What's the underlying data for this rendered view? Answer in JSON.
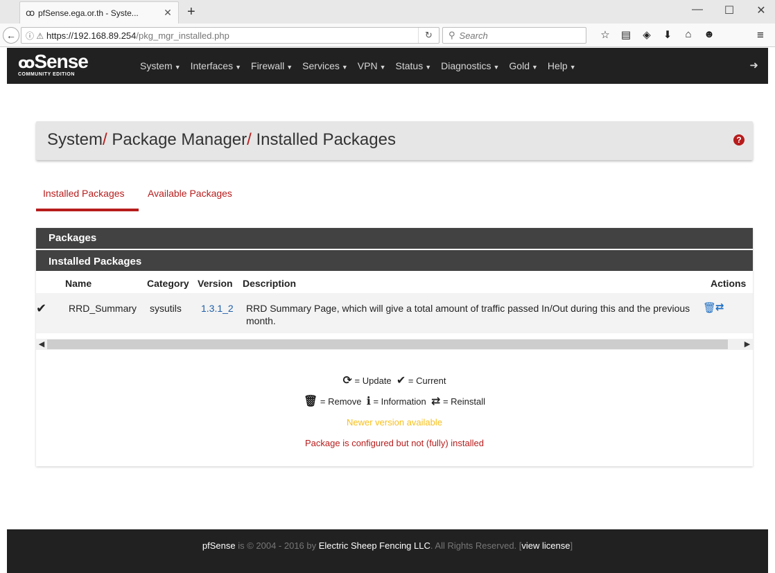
{
  "browser": {
    "tab_title": "pfSense.ega.or.th - Syste...",
    "url_host": "https://192.168.89.254",
    "url_path": "/pkg_mgr_installed.php",
    "search_placeholder": "Search"
  },
  "nav": {
    "brand": "Sense",
    "edition": "COMMUNITY EDITION",
    "menu": [
      "System",
      "Interfaces",
      "Firewall",
      "Services",
      "VPN",
      "Status",
      "Diagnostics",
      "Gold",
      "Help"
    ]
  },
  "breadcrumb": {
    "part1": "System",
    "part2": "Package Manager",
    "part3": "Installed Packages",
    "separator": "/"
  },
  "tabs": {
    "installed": "Installed Packages",
    "available": "Available Packages"
  },
  "panel": {
    "heading": "Packages",
    "subheading": "Installed Packages",
    "columns": {
      "name": "Name",
      "category": "Category",
      "version": "Version",
      "description": "Description",
      "actions": "Actions"
    },
    "rows": [
      {
        "name": "RRD_Summary",
        "category": "sysutils",
        "version": "1.3.1_2",
        "description": "RRD Summary Page, which will give a total amount of traffic passed In/Out during this and the previous month."
      }
    ]
  },
  "legend": {
    "update": "= Update",
    "current": "= Current",
    "remove": "= Remove",
    "information": "= Information",
    "reinstall": "= Reinstall",
    "newer": "Newer version available",
    "not_installed": "Package is configured but not (fully) installed",
    "colors": {
      "newer": "#f7c01c",
      "not_installed": "#b71c1c"
    }
  },
  "footer": {
    "brand": "pfSense",
    "text1": " is © 2004 - 2016 by ",
    "company": "Electric Sheep Fencing LLC",
    "text2": ". All Rights Reserved. [",
    "license": "view license",
    "text3": "]"
  },
  "theme": {
    "accent": "#b71c1c",
    "nav_bg": "#212121",
    "panel_header": "#424242"
  }
}
